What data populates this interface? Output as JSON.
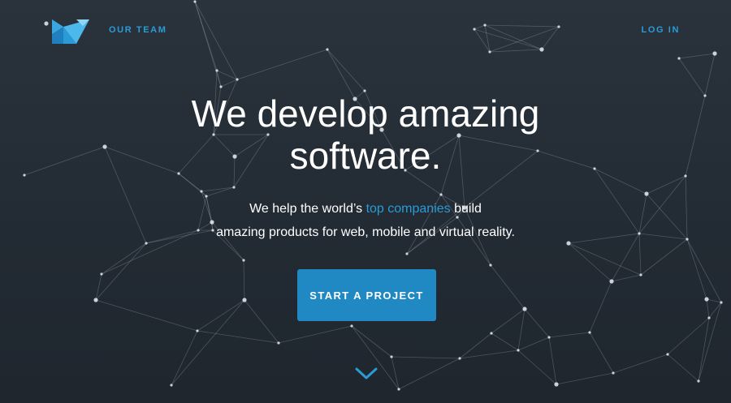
{
  "nav": {
    "our_team": "OUR TEAM",
    "log_in": "LOG IN"
  },
  "hero": {
    "title_line1": "We develop amazing",
    "title_line2": "software.",
    "subtitle_before": "We help the world’s ",
    "subtitle_link": "top companies",
    "subtitle_after": " build",
    "subtitle_line2": "amazing products for web, mobile and virtual reality."
  },
  "cta": {
    "label": "START A PROJECT"
  },
  "icons": {
    "logo": "brand-logo-icon",
    "scroll": "chevron-down-icon"
  },
  "colors": {
    "accent": "#2b9bd6",
    "button": "#2088c2",
    "background": "#252d36",
    "text": "#ffffff"
  }
}
